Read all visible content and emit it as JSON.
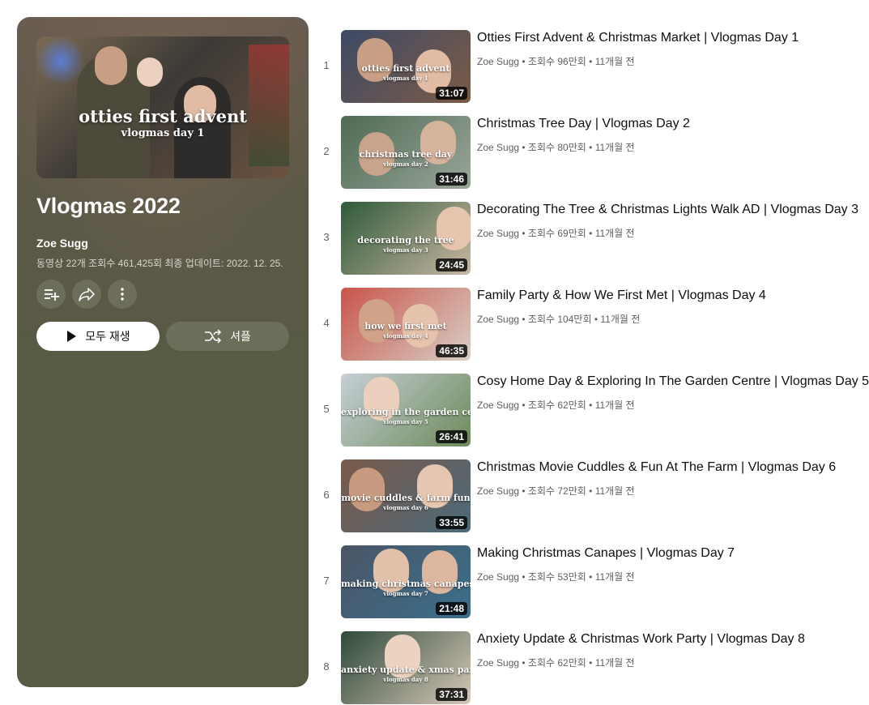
{
  "playlist": {
    "hero_line1": "otties first advent",
    "hero_line2": "vlogmas day 1",
    "title": "Vlogmas 2022",
    "owner": "Zoe Sugg",
    "meta": "동영상 22개  조회수 461,425회  최종 업데이트: 2022. 12. 25.",
    "play_all_label": "모두 재생",
    "shuffle_label": "셔플",
    "icons": [
      "add-to-queue-icon",
      "share-icon",
      "more-icon",
      "play-icon",
      "shuffle-icon"
    ]
  },
  "videos": [
    {
      "index": "1",
      "title": "Otties First Advent & Christmas Market | Vlogmas Day 1",
      "channel": "Zoe Sugg",
      "views": "조회수 96만회",
      "age": "11개월 전",
      "duration": "31:07",
      "thumb_line1": "otties first advent",
      "thumb_line2": "vlogmas day 1",
      "bg1": "#3e4a66",
      "bg2": "#7b5b46"
    },
    {
      "index": "2",
      "title": "Christmas Tree Day | Vlogmas Day 2",
      "channel": "Zoe Sugg",
      "views": "조회수 80만회",
      "age": "11개월 전",
      "duration": "31:46",
      "thumb_line1": "christmas tree day",
      "thumb_line2": "vlogmas day 2",
      "bg1": "#4f6b54",
      "bg2": "#9aa69a"
    },
    {
      "index": "3",
      "title": "Decorating The Tree & Christmas Lights Walk AD | Vlogmas Day 3",
      "channel": "Zoe Sugg",
      "views": "조회수 69만회",
      "age": "11개월 전",
      "duration": "24:45",
      "thumb_line1": "decorating the tree",
      "thumb_line2": "vlogmas day 3",
      "bg1": "#2f5a3a",
      "bg2": "#c9b7a2"
    },
    {
      "index": "4",
      "title": "Family Party & How We First Met | Vlogmas Day 4",
      "channel": "Zoe Sugg",
      "views": "조회수 104만회",
      "age": "11개월 전",
      "duration": "46:35",
      "thumb_line1": "how we first met",
      "thumb_line2": "vlogmas day 4",
      "bg1": "#c9544a",
      "bg2": "#d8cfc6"
    },
    {
      "index": "5",
      "title": "Cosy Home Day & Exploring In The Garden Centre | Vlogmas Day 5",
      "channel": "Zoe Sugg",
      "views": "조회수 62만회",
      "age": "11개월 전",
      "duration": "26:41",
      "thumb_line1": "exploring in the garden centre",
      "thumb_line2": "vlogmas day 5",
      "bg1": "#c6cfd6",
      "bg2": "#6d8a5a"
    },
    {
      "index": "6",
      "title": "Christmas Movie Cuddles & Fun At The Farm | Vlogmas Day 6",
      "channel": "Zoe Sugg",
      "views": "조회수 72만회",
      "age": "11개월 전",
      "duration": "33:55",
      "thumb_line1": "movie cuddles & farm fun",
      "thumb_line2": "vlogmas day 6",
      "bg1": "#7a5a4a",
      "bg2": "#4c6a7a"
    },
    {
      "index": "7",
      "title": "Making Christmas Canapes | Vlogmas Day 7",
      "channel": "Zoe Sugg",
      "views": "조회수 53만회",
      "age": "11개월 전",
      "duration": "21:48",
      "thumb_line1": "making christmas canapes",
      "thumb_line2": "vlogmas day 7",
      "bg1": "#4a5566",
      "bg2": "#3b6f8c"
    },
    {
      "index": "8",
      "title": "Anxiety Update & Christmas Work Party | Vlogmas Day 8",
      "channel": "Zoe Sugg",
      "views": "조회수 62만회",
      "age": "11개월 전",
      "duration": "37:31",
      "thumb_line1": "anxiety update & xmas party",
      "thumb_line2": "vlogmas day 8",
      "bg1": "#2f4a3a",
      "bg2": "#d6c8b8"
    }
  ]
}
